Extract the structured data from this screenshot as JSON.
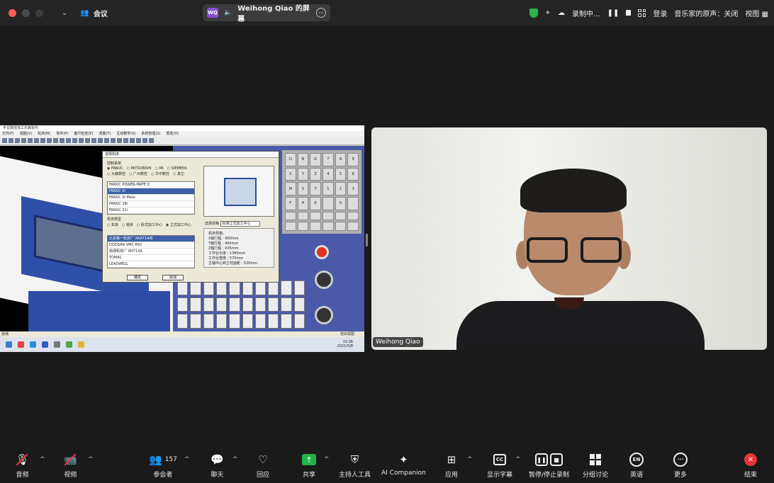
{
  "topbar": {
    "meeting_title": "会议",
    "share_initials": "WQ",
    "share_title": "Weihong Qiao 的屏幕",
    "recording_label": "录制中...",
    "login_label": "登录",
    "original_sound_label": "音乐家的原声：关闭",
    "view_label": "视图"
  },
  "shared_screen": {
    "app_title": "宇龙数控加工仿真软件",
    "menu": [
      "文件(F)",
      "视图(V)",
      "机床(M)",
      "零件(P)",
      "塞尺检查(E)",
      "测量(T)",
      "互动教学(S)",
      "系统管理(S)",
      "帮助(H)"
    ],
    "dialog_title": "选择机床",
    "control_system_label": "控制系统",
    "control_options": [
      "FANUC",
      "MITSUBISHI",
      "PA",
      "SIEMENS",
      "大森数控",
      "广州数控",
      "华中数控",
      "其它"
    ],
    "fanuc_models": [
      "FANUC POWER-MATE 0",
      "FANUC 0i",
      "FANUC 0i Mate",
      "FANUC 18i",
      "FANUC 21i"
    ],
    "machine_type_label": "机床类型",
    "machine_types": [
      "车床",
      "铣床",
      "卧式加工中心",
      "立式加工中心"
    ],
    "machine_list": [
      "北京第一机床厂 XKA714/B",
      "DOOSAN VMC-850",
      "南通机床厂 XH713A",
      "TOMAC",
      "LEADWELL"
    ],
    "select_spec_label": "选择规格",
    "select_spec_value": "标准立式加工中心",
    "specs_label": "机床规格：",
    "specs": [
      {
        "k": "X轴行程",
        "v": "600mm"
      },
      {
        "k": "Y轴行程",
        "v": "400mm"
      },
      {
        "k": "Z轴行程",
        "v": "635mm"
      },
      {
        "k": "工作台长度",
        "v": "1380mm"
      },
      {
        "k": "工作台宽度",
        "v": "570mm"
      },
      {
        "k": "主轴中心到立柱面距",
        "v": "520mm"
      }
    ],
    "ok_label": "确定",
    "cancel_label": "取消",
    "status_left": "就绪",
    "status_right": "自由视图",
    "clock_time": "10:36",
    "clock_date": "2021/5/8"
  },
  "participant": {
    "name": "Weihong Qiao"
  },
  "toolbar": {
    "audio": "音频",
    "video": "视频",
    "participants": "参会者",
    "participants_count": "157",
    "chat": "聊天",
    "react": "回应",
    "share": "共享",
    "host_tools": "主持人工具",
    "ai_companion": "AI Companion",
    "apps": "应用",
    "captions": "显示字幕",
    "record": "暂停/停止录制",
    "breakout": "分组讨论",
    "language_badge": "EN",
    "language": "英语",
    "more": "更多",
    "end": "结束",
    "captions_badge": "CC"
  },
  "colors": {
    "share_green": "#22b34a",
    "end_red": "#e8343a",
    "rec_red": "#e8343a",
    "window_red": "#ff5f57"
  }
}
